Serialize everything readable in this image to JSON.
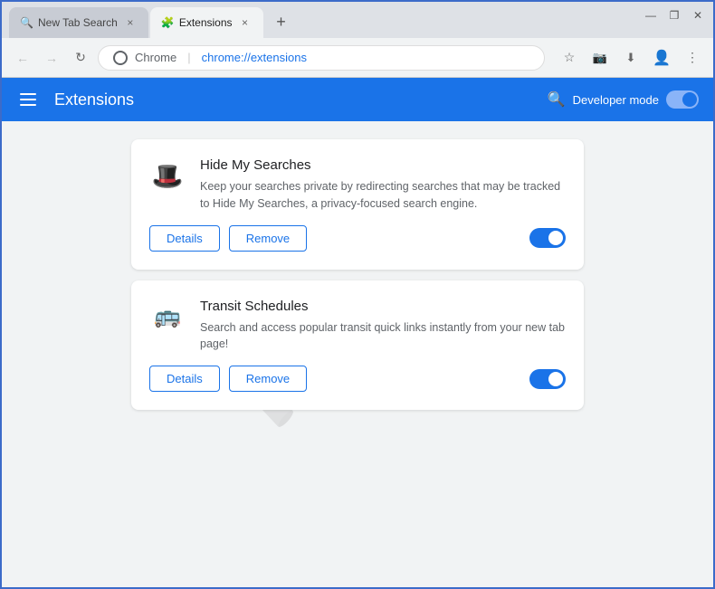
{
  "browser": {
    "tabs": [
      {
        "id": "tab-search",
        "title": "New Tab Search",
        "icon": "🔍",
        "active": false,
        "close_label": "×"
      },
      {
        "id": "tab-extensions",
        "title": "Extensions",
        "icon": "🧩",
        "active": true,
        "close_label": "×"
      }
    ],
    "new_tab_label": "+",
    "window_controls": {
      "minimize": "—",
      "maximize": "❐",
      "close": "✕"
    },
    "address_bar": {
      "back_label": "←",
      "forward_label": "→",
      "reload_label": "↻",
      "site_label": "Chrome",
      "url": "chrome://extensions",
      "bookmark_label": "☆",
      "extensions_label": "⬛",
      "profile_label": "👤",
      "menu_label": "⋮"
    }
  },
  "extensions_page": {
    "header": {
      "menu_label": "☰",
      "title": "Extensions",
      "search_label": "🔍",
      "developer_mode_label": "Developer mode"
    },
    "extensions": [
      {
        "id": "hide-my-searches",
        "name": "Hide My Searches",
        "description": "Keep your searches private by redirecting searches that may be tracked to Hide My Searches, a privacy-focused search engine.",
        "icon": "🎩",
        "enabled": true,
        "details_label": "Details",
        "remove_label": "Remove"
      },
      {
        "id": "transit-schedules",
        "name": "Transit Schedules",
        "description": "Search and access popular transit quick links instantly from your new tab page!",
        "icon": "🚌",
        "enabled": true,
        "details_label": "Details",
        "remove_label": "Remove"
      }
    ]
  }
}
